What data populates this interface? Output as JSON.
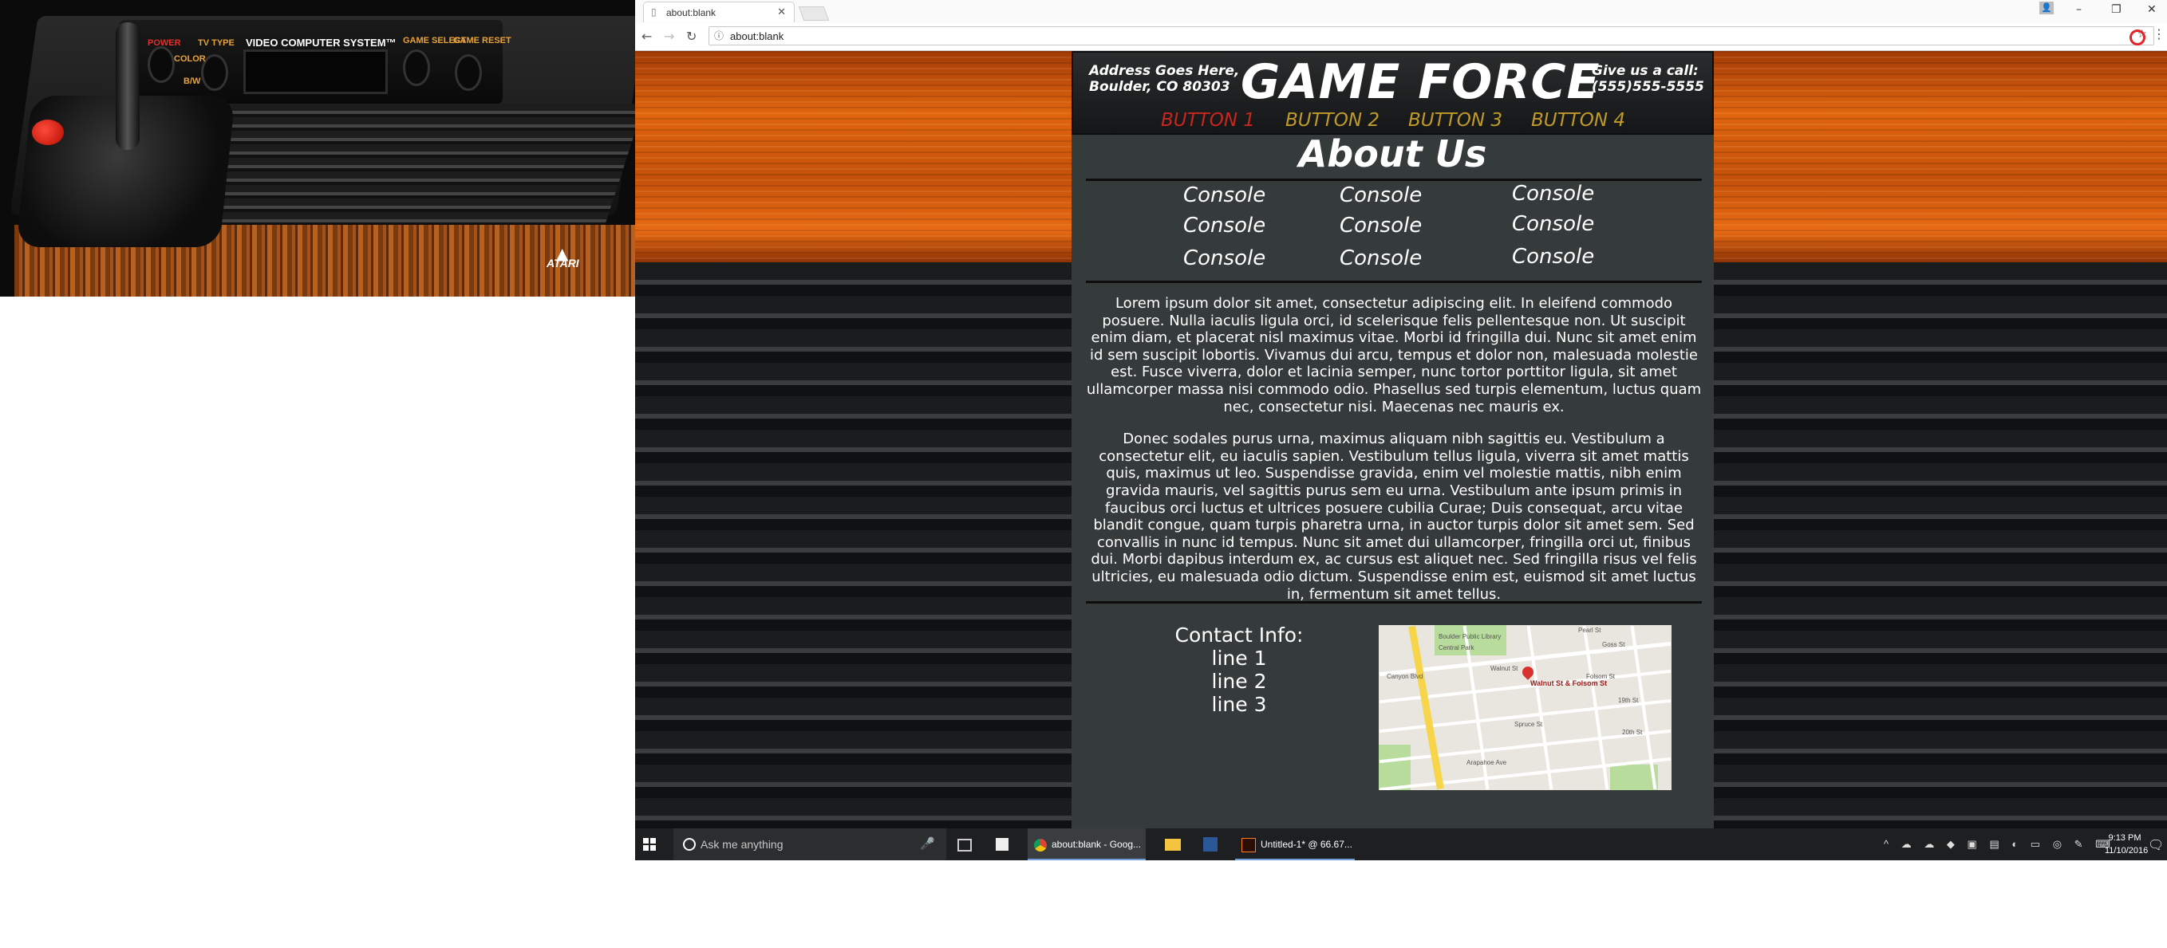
{
  "photo": {
    "brand": "ATARI",
    "panel_labels": [
      "POWER",
      "TV TYPE",
      "COLOR",
      "B/W",
      "VIDEO COMPUTER SYSTEM™",
      "GAME SELECT",
      "GAME RESET"
    ]
  },
  "browser": {
    "tab_title": "about:blank",
    "url": "about:blank"
  },
  "site": {
    "address": "Address Goes Here,\nBoulder, CO 80303",
    "title": "GAME FORCE",
    "call_label": "Give us a call:",
    "phone": "(555)555-5555",
    "nav": [
      "BUTTON 1",
      "BUTTON 2",
      "BUTTON 3",
      "BUTTON 4"
    ],
    "nav_active_color": "#c8261e",
    "nav_color": "#c09a2a",
    "about_title": "About Us",
    "consoles": [
      "Console",
      "Console",
      "Console",
      "Console",
      "Console",
      "Console",
      "Console",
      "Console",
      "Console"
    ],
    "paragraphs": [
      "Lorem ipsum dolor sit amet, consectetur adipiscing elit. In eleifend commodo posuere. Nulla iaculis ligula orci, id scelerisque felis pellentesque non. Ut suscipit enim diam, et placerat nisl maximus vitae. Morbi id fringilla dui. Nunc sit amet enim id sem suscipit lobortis. Vivamus dui arcu, tempus et dolor non, malesuada molestie est. Fusce viverra, dolor et lacinia semper, nunc tortor porttitor ligula, sit amet ullamcorper massa nisi commodo odio. Phasellus sed turpis elementum, luctus quam nec, consectetur nisi. Maecenas nec mauris ex.",
      "Donec sodales purus urna, maximus aliquam nibh sagittis eu. Vestibulum a consectetur elit, eu iaculis sapien. Vestibulum tellus ligula, viverra sit amet mattis quis, maximus ut leo. Suspendisse gravida, enim vel molestie mattis, nibh enim gravida mauris, vel sagittis purus sem eu urna. Vestibulum ante ipsum primis in faucibus orci luctus et ultrices posuere cubilia Curae; Duis consequat, arcu vitae blandit congue, quam turpis pharetra urna, in auctor turpis dolor sit amet sem. Sed convallis in nunc id tempus. Nunc sit amet dui ullamcorper, fringilla orci ut, finibus dui. Morbi dapibus interdum ex, ac cursus est aliquet nec. Sed fringilla risus vel felis ultricies, eu malesuada odio dictum. Suspendisse enim est, euismod sit amet luctus in, fermentum sit amet tellus."
    ],
    "contact_heading": "Contact Info:",
    "contact_lines": [
      "line 1",
      "line 2",
      "line 3"
    ],
    "map_pin_label": "Walnut St & Folsom St",
    "map_labels": [
      "Pearl St",
      "Walnut St",
      "Folsom St",
      "Canyon Blvd",
      "Spruce St",
      "Arapahoe Ave",
      "19th St",
      "20th St",
      "Goss St",
      "Boulder Public Library",
      "Central Park"
    ]
  },
  "taskbar": {
    "search_placeholder": "Ask me anything",
    "apps": [
      "about:blank - Goog...",
      "Untitled-1* @ 66.67..."
    ],
    "time": "9:13 PM",
    "date": "11/10/2016"
  },
  "icons": {
    "tab": "page-icon",
    "close": "close-icon",
    "back": "back-arrow-icon",
    "forward": "forward-arrow-icon",
    "reload": "reload-icon",
    "info": "info-icon",
    "star": "star-icon",
    "opera": "opera-icon",
    "menu": "menu-icon",
    "start": "windows-start-icon",
    "cortana": "cortana-icon",
    "mic": "microphone-icon"
  }
}
